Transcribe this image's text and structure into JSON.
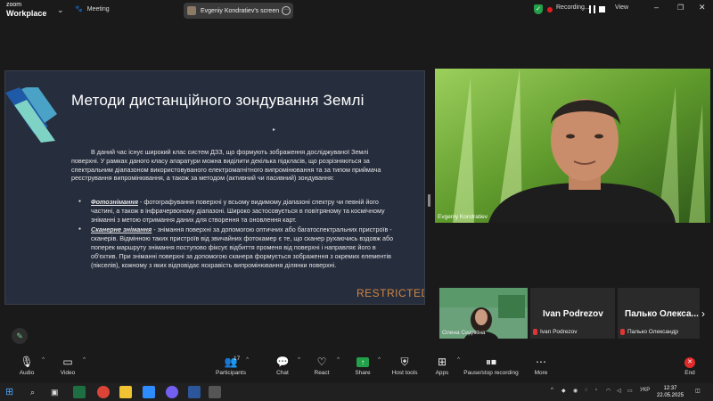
{
  "app": {
    "logo_line1": "zoom",
    "logo_line2": "Workplace"
  },
  "topbar": {
    "meeting_label": "Meeting",
    "screen_share_label": "Evgeniy Kondratiev's screen",
    "recording_label": "Recording...",
    "view_label": "View"
  },
  "slide": {
    "title": "Методи дистанційного зондування Землі",
    "paragraph": "В даний час існує широкий клас систем ДЗЗ, що формують зображення досліджуваної Землі поверхні. У рамках даного класу апаратури можна виділити декілька підкласів, що розрізняються за спектральним діапазоном використовуваного електромагнітного випромінювання та за типом приймача реєстрування випромінювання, а також за методом (активний чи пасивний) зондування:",
    "bullets": [
      {
        "term": "Фотознімання",
        "text": " - фотографування поверхні у всьому видимому діапазоні спектру чи певній його частині, а також в інфрачервоному діапазоні. Широко застосовується в повітряному та космічному зніманні з метою отримання даних для створення та оновлення карт."
      },
      {
        "term": "Сканерне знімання",
        "text": " - знімання поверхні за допомогою оптичних або багатоспектральних пристроїв - сканерів. Відмінною таких пристроїв від звичайних фотокамер є те, що сканер рухаючись вздовж або поперек маршруту знімання поступово фіксує відбиття променя від поверхні і направляє його в об'єктив. При зніманні поверхні за допомогою сканера формується зображення з окремих елементів (пікселів), кожному з яких відповідає яскравість випромінювання ділянки поверхні."
      }
    ],
    "restricted_label": "RESTRICTED"
  },
  "video": {
    "speaker_name": "Evgeniy Kondratiev"
  },
  "participants": [
    {
      "name": "Олена Сидякіна",
      "big_name": ""
    },
    {
      "name": "Ivan Podrezov",
      "big_name": "Ivan Podrezov"
    },
    {
      "name": "Палько Олександр",
      "big_name": "Палько Олекса..."
    }
  ],
  "toolbar": {
    "audio": "Audio",
    "video": "Video",
    "participants": "Participants",
    "participants_count": "17",
    "chat": "Chat",
    "react": "React",
    "share": "Share",
    "host_tools": "Host tools",
    "apps": "Apps",
    "pause_stop": "Pause/stop recording",
    "more": "More",
    "end": "End"
  },
  "taskbar": {
    "lang": "УКР",
    "time": "12:37",
    "date": "22.05.2025"
  },
  "colors": {
    "accent_green": "#23a14a",
    "end_red": "#e02b2b",
    "slide_bg": "#262d3d",
    "restricted": "#d4863e"
  }
}
